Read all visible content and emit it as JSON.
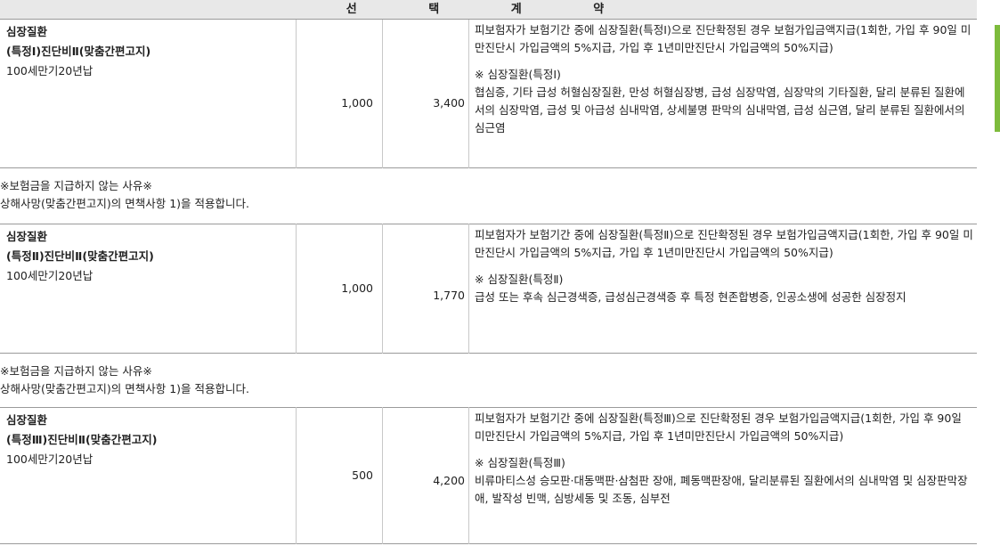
{
  "header": {
    "title": "선 택 계 약"
  },
  "items": [
    {
      "name_line1": "심장질환",
      "name_line2": "(특정Ⅰ)진단비Ⅱ(맞춤간편고지)",
      "term": "100세만기20년납",
      "amount": "1,000",
      "premium": "3,400",
      "desc_main": "피보험자가 보험기간 중에 심장질환(특정Ⅰ)으로 진단확정된 경우 보험가입금액지급(1회한, 가입 후 90일 미만진단시 가입금액의 5%지급, 가입 후 1년미만진단시 가입금액의 50%지급)",
      "desc_title": "※ 심장질환(특정Ⅰ)",
      "desc_detail": "협심증, 기타 급성 허혈심장질환, 만성 허혈심장병, 급성 심장막염, 심장막의 기타질환, 달리 분류된 질환에서의 심장막염, 급성 및 아급성 심내막염, 상세불명 판막의 심내막염, 급성 심근염, 달리 분류된 질환에서의 심근염"
    },
    {
      "name_line1": "심장질환",
      "name_line2": "(특정Ⅱ)진단비Ⅱ(맞춤간편고지)",
      "term": "100세만기20년납",
      "amount": "1,000",
      "premium": "1,770",
      "desc_main": "피보험자가 보험기간 중에 심장질환(특정Ⅱ)으로 진단확정된 경우 보험가입금액지급(1회한, 가입 후 90일 미만진단시 가입금액의 5%지급, 가입 후 1년미만진단시 가입금액의 50%지급)",
      "desc_title": "※ 심장질환(특정Ⅱ)",
      "desc_detail": "급성 또는 후속 심근경색증, 급성심근경색증 후 특정 현존합병증, 인공소생에 성공한 심장정지"
    },
    {
      "name_line1": "심장질환",
      "name_line2": "(특정Ⅲ)진단비Ⅱ(맞춤간편고지)",
      "term": "100세만기20년납",
      "amount": "500",
      "premium": "4,200",
      "desc_main": "피보험자가 보험기간 중에 심장질환(특정Ⅲ)으로 진단확정된 경우 보험가입금액지급(1회한, 가입 후 90일 미만진단시 가입금액의 5%지급, 가입 후 1년미만진단시 가입금액의 50%지급)",
      "desc_title": "※ 심장질환(특정Ⅲ)",
      "desc_detail": "비류마티스성 승모판·대동맥판·삼첨판 장애, 폐동맥판장애, 달리분류된 질환에서의 심내막염 및 심장판막장애, 발작성 빈맥, 심방세동 및 조동, 심부전"
    }
  ],
  "notes": [
    {
      "line1": "※보험금을 지급하지 않는 사유※",
      "line2": "상해사망(맞춤간편고지)의 면책사항 1)을 적용합니다."
    },
    {
      "line1": "※보험금을 지급하지 않는 사유※",
      "line2": "상해사망(맞춤간편고지)의 면책사항 1)을 적용합니다."
    }
  ]
}
